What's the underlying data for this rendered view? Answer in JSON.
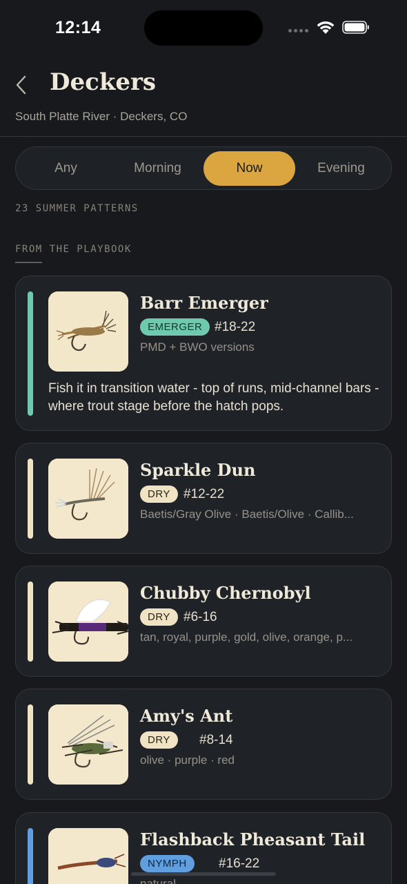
{
  "status_bar": {
    "time": "12:14"
  },
  "header": {
    "title": "Deckers",
    "subtitle": "South Platte River · Deckers, CO"
  },
  "time_filter": {
    "options": [
      "Any",
      "Morning",
      "Now",
      "Evening"
    ],
    "selected": "Now"
  },
  "counts": {
    "patterns_label": "23 SUMMER PATTERNS"
  },
  "section": {
    "playbook_label": "FROM THE PLAYBOOK"
  },
  "colors": {
    "accent": "#dba640",
    "emerger": "#6fc9ad",
    "dry": "#efe3c4",
    "nymph": "#5f9fe0"
  },
  "patterns": [
    {
      "name": "Barr Emerger",
      "type": "EMERGER",
      "size": "#18-22",
      "variants": "PMD + BWO versions",
      "note": "Fish it in transition water - top of runs, mid-channel bars - where trout stage before the hatch pops.",
      "icon": "barr-emerger-fly-icon"
    },
    {
      "name": "Sparkle Dun",
      "type": "DRY",
      "size": "#12-22",
      "variants": "Baetis/Gray Olive · Baetis/Olive · Callib...",
      "icon": "sparkle-dun-fly-icon"
    },
    {
      "name": "Chubby Chernobyl",
      "type": "DRY",
      "size": "#6-16",
      "variants": "tan, royal, purple, gold, olive, orange, p...",
      "icon": "chubby-chernobyl-fly-icon"
    },
    {
      "name": "Amy's Ant",
      "type": "DRY",
      "size": "#8-14",
      "variants": "olive · purple · red",
      "icon": "amys-ant-fly-icon"
    },
    {
      "name": "Flashback Pheasant Tail",
      "type": "NYMPH",
      "size": "#16-22",
      "variants": "natural",
      "icon": "flashback-pheasant-tail-fly-icon"
    }
  ]
}
